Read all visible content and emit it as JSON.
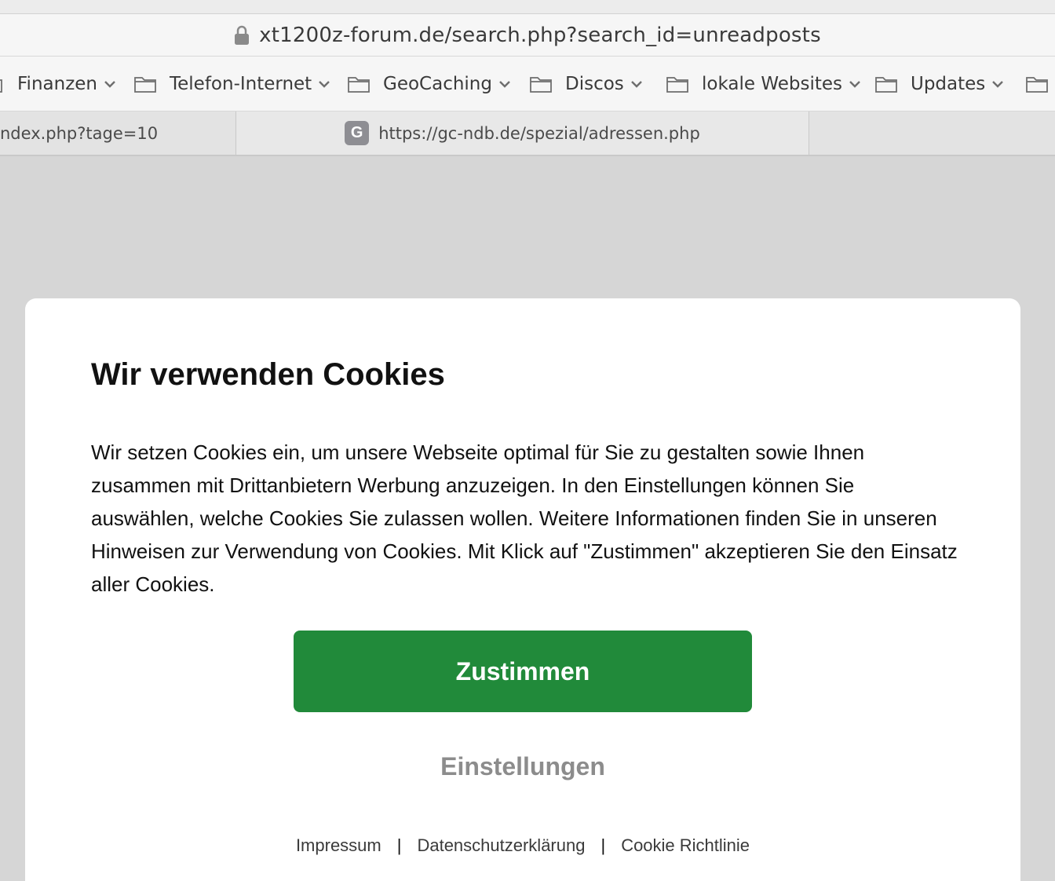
{
  "browser": {
    "url": "xt1200z-forum.de/search.php?search_id=unreadposts",
    "bookmarks": [
      {
        "label": "Finanzen"
      },
      {
        "label": "Telefon-Internet"
      },
      {
        "label": "GeoCaching"
      },
      {
        "label": "Discos"
      },
      {
        "label": "lokale Websites"
      },
      {
        "label": "Updates"
      }
    ],
    "tabs": [
      {
        "title": "ndex.php?tage=10"
      },
      {
        "favicon_letter": "G",
        "title": "https://gc-ndb.de/spezial/adressen.php"
      }
    ]
  },
  "cookie_dialog": {
    "title": "Wir verwenden Cookies",
    "body": "Wir setzen Cookies ein, um unsere Webseite optimal für Sie zu gestalten sowie Ihnen zusammen mit Drittanbietern Werbung anzuzeigen. In den Einstellungen können Sie auswählen, welche Cookies Sie zulassen wollen. Weitere Informationen finden Sie in unseren Hinweisen zur Verwendung von Cookies. Mit Klick auf \"Zustimmen\" akzeptieren Sie den Einsatz aller Cookies.",
    "accept_label": "Zustimmen",
    "settings_label": "Einstellungen",
    "footer_links": {
      "imprint": "Impressum",
      "privacy": "Datenschutzerklärung",
      "cookie_policy": "Cookie Richtlinie",
      "separator": "|"
    }
  },
  "colors": {
    "accept_button": "#218a3a",
    "settings_text": "#8c8c8c",
    "page_background": "#d6d6d6"
  },
  "icons": [
    "lock-icon",
    "folder-icon",
    "chevron-down-icon",
    "favicon"
  ]
}
